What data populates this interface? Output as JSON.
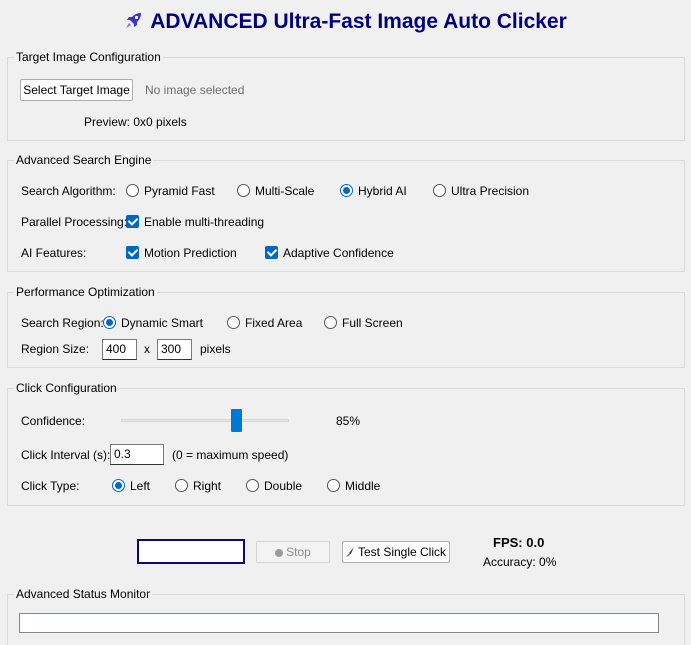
{
  "app": {
    "title": "ADVANCED Ultra-Fast Image Auto Clicker",
    "title_icon": "rocket-icon"
  },
  "target": {
    "legend": "Target Image Configuration",
    "select_button": "Select Target Image",
    "no_image_text": "No image selected",
    "preview_text": "Preview: 0x0 pixels"
  },
  "search_engine": {
    "legend": "Advanced Search Engine",
    "algorithm_label": "Search Algorithm:",
    "algorithms": [
      "Pyramid Fast",
      "Multi-Scale",
      "Hybrid AI",
      "Ultra Precision"
    ],
    "selected_algorithm": "Hybrid AI",
    "parallel_label": "Parallel Processing:",
    "multithreading_label": "Enable multi-threading",
    "multithreading_checked": true,
    "ai_label": "AI Features:",
    "motion_prediction_label": "Motion Prediction",
    "motion_prediction_checked": true,
    "adaptive_confidence_label": "Adaptive Confidence",
    "adaptive_confidence_checked": true
  },
  "performance": {
    "legend": "Performance Optimization",
    "region_label": "Search Region:",
    "regions": [
      "Dynamic Smart",
      "Fixed Area",
      "Full Screen"
    ],
    "selected_region": "Dynamic Smart",
    "size_label": "Region Size:",
    "width": "400",
    "separator": "x",
    "height": "300",
    "unit": "pixels"
  },
  "click": {
    "legend": "Click Configuration",
    "confidence_label": "Confidence:",
    "confidence_value": "85%",
    "confidence_fraction": 0.85,
    "interval_label": "Click Interval (s):",
    "interval_value": "0.3",
    "interval_hint": "(0 = maximum speed)",
    "type_label": "Click Type:",
    "types": [
      "Left",
      "Right",
      "Double",
      "Middle"
    ],
    "selected_type": "Left"
  },
  "controls": {
    "start_label": "",
    "stop_label": "Stop",
    "stop_icon": "record-icon",
    "test_label": "Test Single Click",
    "test_icon": "brush-icon",
    "fps_text": "FPS: 0.0",
    "accuracy_text": "Accuracy: 0%"
  },
  "status": {
    "legend": "Advanced Status Monitor",
    "text": ""
  },
  "colors": {
    "title": "#000080",
    "accent": "#0067c0",
    "background": "#f0f0f0"
  }
}
